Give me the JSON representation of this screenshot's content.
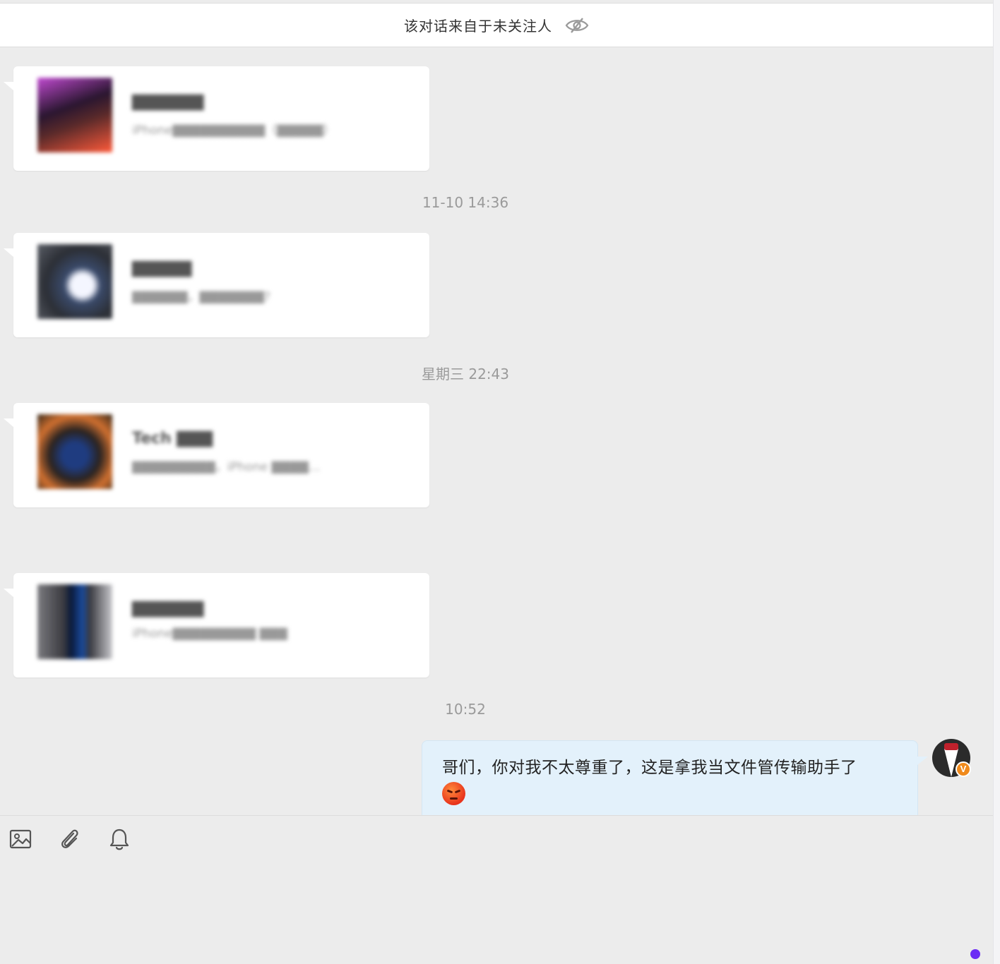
{
  "header": {
    "notice": "该对话来自于未关注人",
    "hidden_icon": "eye-slash-icon"
  },
  "messages": [
    {
      "type": "link-card",
      "title": "▇▇▇▇▇▇",
      "desc": "iPhone▇▇▇▇▇▇▇▇▇▇（▇▇▇▇▇）"
    },
    {
      "type": "timestamp",
      "text": "11-10 14:36"
    },
    {
      "type": "link-card",
      "title": "▇▇▇▇▇",
      "desc": "▇▇▇▇▇▇，▇▇▇▇▇▇▇?"
    },
    {
      "type": "timestamp",
      "text": "星期三 22:43"
    },
    {
      "type": "link-card",
      "title": "Tech ▇▇▇",
      "desc": "▇▇▇▇▇▇▇▇▇，iPhone ▇▇▇▇…"
    },
    {
      "type": "link-card",
      "title": "▇▇▇▇▇▇",
      "desc": "iPhone▇▇▇▇▇▇▇▇▇ ▇▇▇"
    },
    {
      "type": "timestamp",
      "text": "10:52"
    }
  ],
  "my_message": {
    "text": "哥们，你对我不太尊重了，这是拿我当文件管传输助手了",
    "emoji": "angry-face-emoji",
    "avatar_badge": "V"
  },
  "composer": {
    "tools": [
      "image-icon",
      "paperclip-icon",
      "bell-icon"
    ]
  },
  "colors": {
    "background": "#ececec",
    "my_bubble": "#e3f1fb",
    "badge": "#f08a1c",
    "status_dot": "#6c2cf5"
  }
}
